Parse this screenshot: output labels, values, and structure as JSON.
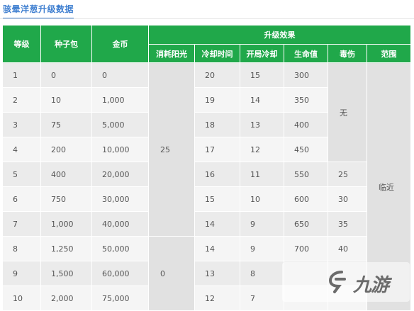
{
  "page_title": "骇晕洋葱升级数据",
  "table": {
    "headers": {
      "level": "等级",
      "seed_pack": "种子包",
      "gold": "金币",
      "upgrade_effect": "升级效果",
      "sun_cost": "消耗阳光",
      "cooldown": "冷却时间",
      "start_cooldown": "开局冷却",
      "hp": "生命值",
      "poison": "毒伤",
      "range": "范围"
    },
    "rows": [
      {
        "level": "1",
        "seed_pack": "0",
        "gold": "0",
        "cooldown": "20",
        "start_cooldown": "15",
        "hp": "300"
      },
      {
        "level": "2",
        "seed_pack": "10",
        "gold": "1,000",
        "cooldown": "19",
        "start_cooldown": "14",
        "hp": "350"
      },
      {
        "level": "3",
        "seed_pack": "75",
        "gold": "5,000",
        "cooldown": "18",
        "start_cooldown": "13",
        "hp": "400"
      },
      {
        "level": "4",
        "seed_pack": "200",
        "gold": "10,000",
        "cooldown": "17",
        "start_cooldown": "12",
        "hp": "450"
      },
      {
        "level": "5",
        "seed_pack": "400",
        "gold": "20,000",
        "cooldown": "16",
        "start_cooldown": "11",
        "hp": "550",
        "poison": "25"
      },
      {
        "level": "6",
        "seed_pack": "750",
        "gold": "30,000",
        "cooldown": "15",
        "start_cooldown": "10",
        "hp": "600",
        "poison": "30"
      },
      {
        "level": "7",
        "seed_pack": "1,000",
        "gold": "40,000",
        "cooldown": "14",
        "start_cooldown": "9",
        "hp": "650",
        "poison": "35"
      },
      {
        "level": "8",
        "seed_pack": "1,250",
        "gold": "50,000",
        "cooldown": "14",
        "start_cooldown": "9",
        "hp": "700",
        "poison": "40"
      },
      {
        "level": "9",
        "seed_pack": "1,500",
        "gold": "60,000",
        "cooldown": "13",
        "start_cooldown": "8"
      },
      {
        "level": "10",
        "seed_pack": "2,000",
        "gold": "75,000",
        "cooldown": "12",
        "start_cooldown": "7"
      }
    ],
    "merged": {
      "sun_cost_low": "25",
      "sun_cost_high": "0",
      "poison_none": "无",
      "range": "临近"
    }
  },
  "watermark": {
    "text": "九游",
    "logo_icon": "jiuyou-logo-icon"
  },
  "colors": {
    "header_green": "#20a84a",
    "title_blue": "#3f7fd0"
  }
}
